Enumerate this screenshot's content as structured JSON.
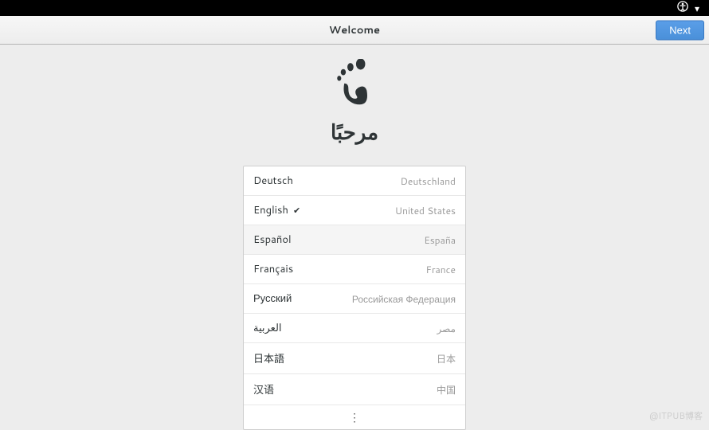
{
  "topbar": {
    "accessibility_icon": "accessibility",
    "dropdown_icon": "▾"
  },
  "header": {
    "title": "Welcome",
    "next_label": "Next"
  },
  "greeting": "مرحبًا",
  "languages": [
    {
      "name": "Deutsch",
      "country": "Deutschland",
      "selected": false
    },
    {
      "name": "English",
      "country": "United States",
      "selected": true
    },
    {
      "name": "Español",
      "country": "España",
      "selected": false,
      "hover": true
    },
    {
      "name": "Français",
      "country": "France",
      "selected": false
    },
    {
      "name": "Русский",
      "country": "Российская Федерация",
      "selected": false
    },
    {
      "name": "العربية",
      "country": "مصر",
      "selected": false
    },
    {
      "name": "日本語",
      "country": "日本",
      "selected": false
    },
    {
      "name": "汉语",
      "country": "中国",
      "selected": false
    }
  ],
  "more_icon": "⋮",
  "watermark": "@ITPUB博客"
}
